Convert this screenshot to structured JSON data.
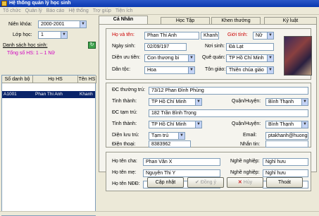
{
  "window": {
    "title": "Hệ thống quản lý học sinh"
  },
  "menu": [
    "Tổ chức",
    "Quản lý",
    "Báo cáo",
    "Hệ thống",
    "Trợ giúp",
    "Tiện ích"
  ],
  "left": {
    "nien_khoa_label": "Niên khóa:",
    "nien_khoa_value": "2000-2001",
    "lop_hoc_label": "Lớp học:",
    "lop_hoc_value": "1",
    "list_label": "Danh sách học sinh:",
    "total": "Tổng số HS: 1 – 1 Nữ",
    "columns": [
      "Số danh bộ",
      "Họ HS",
      "Tên HS"
    ],
    "rows": [
      {
        "sdb": "A1001",
        "ho": "Phan Thi Anh",
        "ten": "Khanh"
      }
    ]
  },
  "tabs": [
    "Cá Nhân",
    "Học Tập",
    "Khen thưởng",
    "Kỷ luật"
  ],
  "personal": {
    "ho_ten_label": "Họ và tên:",
    "ho_value": "Phan Thi Anh",
    "ten_value": "Khanh",
    "gioi_tinh_label": "Giới tính:",
    "gioi_tinh_value": "Nữ",
    "ngay_sinh_label": "Ngày sinh:",
    "ngay_sinh_value": "02/09/197",
    "noi_sinh_label": "Nơi sinh:",
    "noi_sinh_value": "Đà Lạt",
    "dien_uu_tien_label": "Diện ưu tiên:",
    "dien_uu_tien_value": "Con thương bi",
    "que_quan_label": "Quê quán:",
    "que_quan_value": "TP Hồ Chí Minh",
    "dan_toc_label": "Dân tộc:",
    "dan_toc_value": "Hoa",
    "ton_giao_label": "Tôn giáo:",
    "ton_giao_value": "Thiên chúa giáo"
  },
  "address": {
    "dc_thuong_tru_label": "ĐC thường trú:",
    "dc_thuong_tru_value": "73/12 Phan Đình Phùng",
    "tinh_thanh_label": "Tỉnh thành:",
    "tinh_thanh_value": "TP Hồ Chí Minh",
    "quan_huyen_label": "Quận/Huyện:",
    "quan_huyen_value": "Bình Thạnh",
    "dc_tam_tru_label": "ĐC tạm trú:",
    "dc_tam_tru_value": "182 Trần Bình Trọng",
    "tinh_thanh2_value": "TP Hồ Chí Minh",
    "quan_huyen2_value": "Bình Thạnh",
    "dien_luu_tru_label": "Diện lưu trú:",
    "dien_luu_tru_value": "Tạm trú",
    "email_label": "Email:",
    "email_value": "ptakhanh@huongsen.co",
    "dien_thoai_label": "Điện thoại:",
    "dien_thoai_value": "8383962",
    "nhan_tin_label": "Nhắn tin:",
    "nhan_tin_value": ""
  },
  "parents": {
    "cha_label": "Họ tên cha:",
    "cha_value": "Phan Văn X",
    "me_label": "Họ tên mẹ:",
    "me_value": "Nguyễn Thi Y",
    "ndd_label": "Họ tên NĐĐ:",
    "ndd_value": "",
    "nghe_label": "Nghề nghiệp:",
    "nghe_cha": "Nghỉ hưu",
    "nghe_me": "Nghỉ hưu",
    "nghe_ndd": ""
  },
  "buttons": {
    "update": "Cập nhật",
    "agree": "Đồng ý",
    "cancel": "Hủy",
    "exit": "Thoát"
  }
}
